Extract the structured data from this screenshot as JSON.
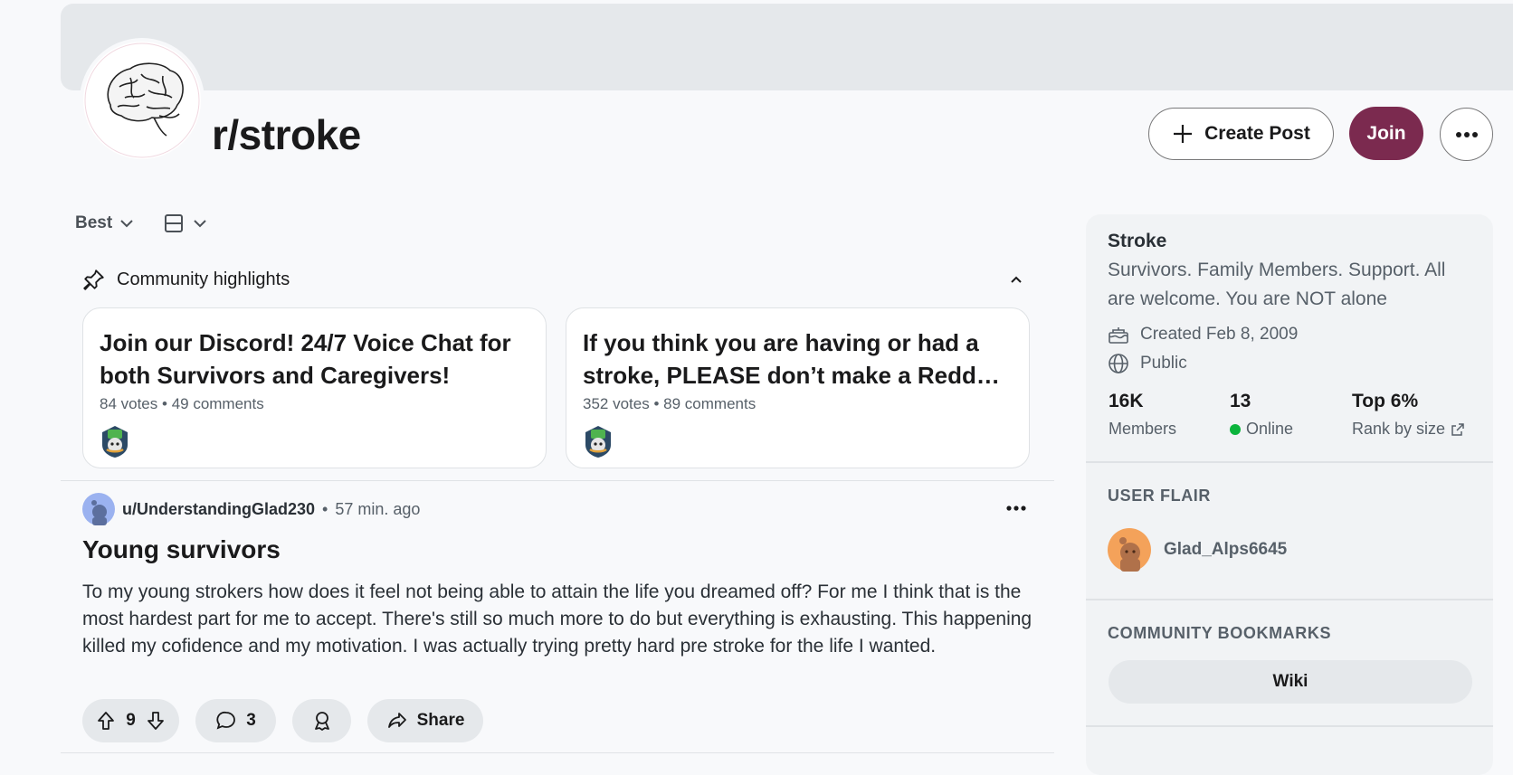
{
  "subreddit": {
    "name": "r/stroke",
    "create_post_label": "Create Post",
    "join_label": "Join"
  },
  "feed": {
    "sort_label": "Best",
    "highlights_label": "Community highlights",
    "highlights": [
      {
        "title": "Join our Discord! 24/7 Voice Chat for both Survivors and Caregivers!",
        "votes": "84 votes",
        "comments": "49 comments"
      },
      {
        "title": "If you think you are having or had a stroke, PLEASE don’t make a Redd…",
        "votes": "352 votes",
        "comments": "89 comments"
      }
    ],
    "post": {
      "author": "u/UnderstandingGlad230",
      "time": "57 min. ago",
      "title": "Young survivors",
      "body": "To my young strokers how does it feel not being able to attain the life you dreamed off? For me I think that is the most hardest part for me to accept. There's still so much more to do but everything is exhausting. This happening killed my cofidence and my motivation. I was actually trying pretty hard pre stroke for the life I wanted.",
      "votes": "9",
      "comments": "3",
      "share_label": "Share"
    }
  },
  "sidebar": {
    "title": "Stroke",
    "description": "Survivors. Family Members. Support. All are welcome. You are NOT alone",
    "created": "Created Feb 8, 2009",
    "visibility": "Public",
    "stats": [
      {
        "value": "16K",
        "label": "Members"
      },
      {
        "value": "13",
        "label": "Online"
      },
      {
        "value": "Top 6%",
        "label": "Rank by size"
      }
    ],
    "user_flair_heading": "USER FLAIR",
    "user_flair_name": "Glad_Alps6645",
    "bookmarks_heading": "COMMUNITY BOOKMARKS",
    "bookmark_wiki": "Wiki",
    "colors": {
      "join": "#7b2a4f",
      "online": "#0bb43c"
    }
  }
}
